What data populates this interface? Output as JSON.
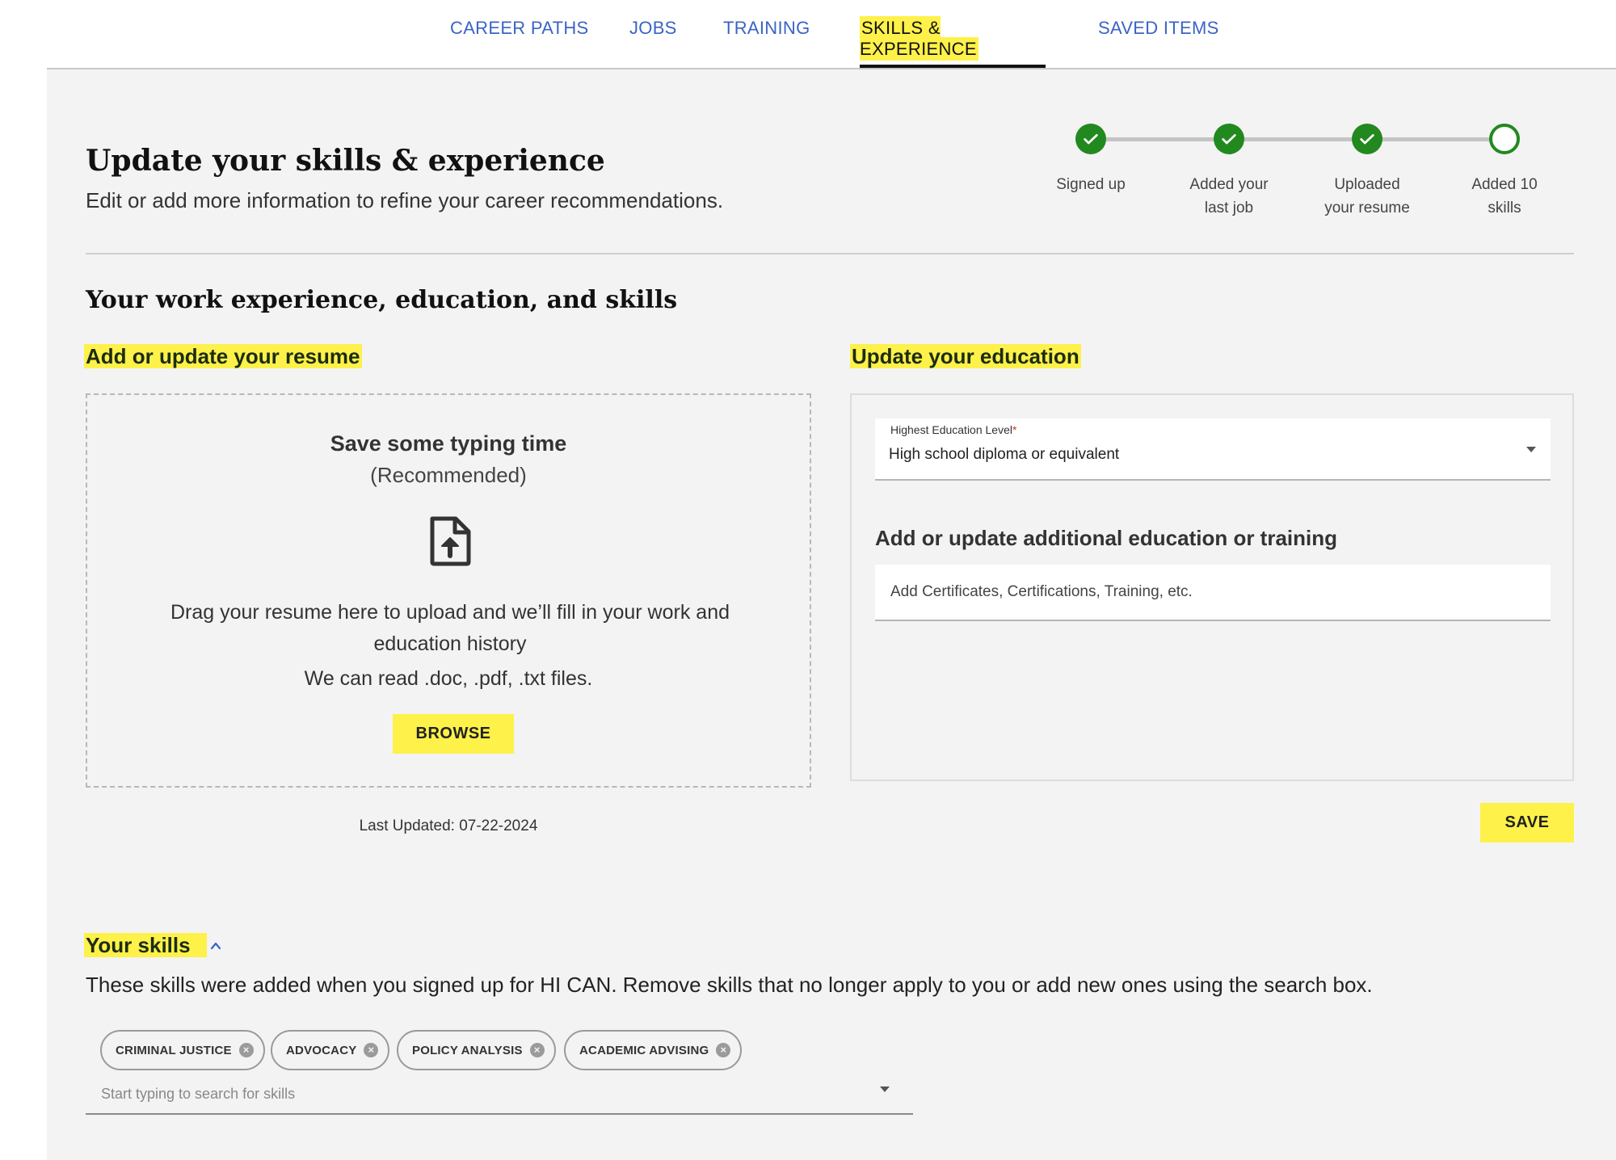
{
  "nav": {
    "tabs": [
      {
        "label": "CAREER PATHS"
      },
      {
        "label": "JOBS"
      },
      {
        "label": "TRAINING"
      },
      {
        "label": "SKILLS & EXPERIENCE",
        "active": true
      },
      {
        "label": "SAVED ITEMS"
      }
    ]
  },
  "header": {
    "title": "Update your skills & experience",
    "subtitle": "Edit or add more information to refine your career recommendations."
  },
  "progress": {
    "steps": [
      {
        "line1": "Signed up",
        "line2": "",
        "done": true
      },
      {
        "line1": "Added your",
        "line2": "last job",
        "done": true
      },
      {
        "line1": "Uploaded",
        "line2": "your resume",
        "done": true
      },
      {
        "line1": "Added 10",
        "line2": "skills",
        "done": false
      }
    ]
  },
  "section": {
    "title": "Your work experience, education, and skills"
  },
  "resume": {
    "heading": "Add or update your resume",
    "dz_title": "Save some typing time",
    "dz_subtitle": "(Recommended)",
    "dz_body": "Drag your resume here to upload and we’ll fill in your work and education history",
    "dz_formats": "We can read .doc, .pdf, .txt files.",
    "browse_label": "BROWSE",
    "last_updated": "Last Updated: 07-22-2024",
    "icon": "file-upload-icon"
  },
  "education": {
    "heading": "Update your education",
    "level_label": "Highest Education Level",
    "level_required": "*",
    "level_value": "High school diploma or equivalent",
    "additional_title": "Add or update additional education or training",
    "additional_placeholder": "Add Certificates, Certifications, Training, etc.",
    "save_label": "SAVE"
  },
  "skills": {
    "heading": "Your skills",
    "description": "These skills were added when you signed up for HI CAN. Remove skills that no longer apply to you or add new ones using the search box.",
    "chips": [
      "CRIMINAL JUSTICE",
      "ADVOCACY",
      "POLICY ANALYSIS",
      "ACADEMIC ADVISING"
    ],
    "search_placeholder": "Start typing to search for skills"
  },
  "colors": {
    "accent_yellow": "#fdf14a",
    "link_blue": "#3b64c4",
    "step_green": "#22891f",
    "page_bg": "#f3f3f3"
  }
}
